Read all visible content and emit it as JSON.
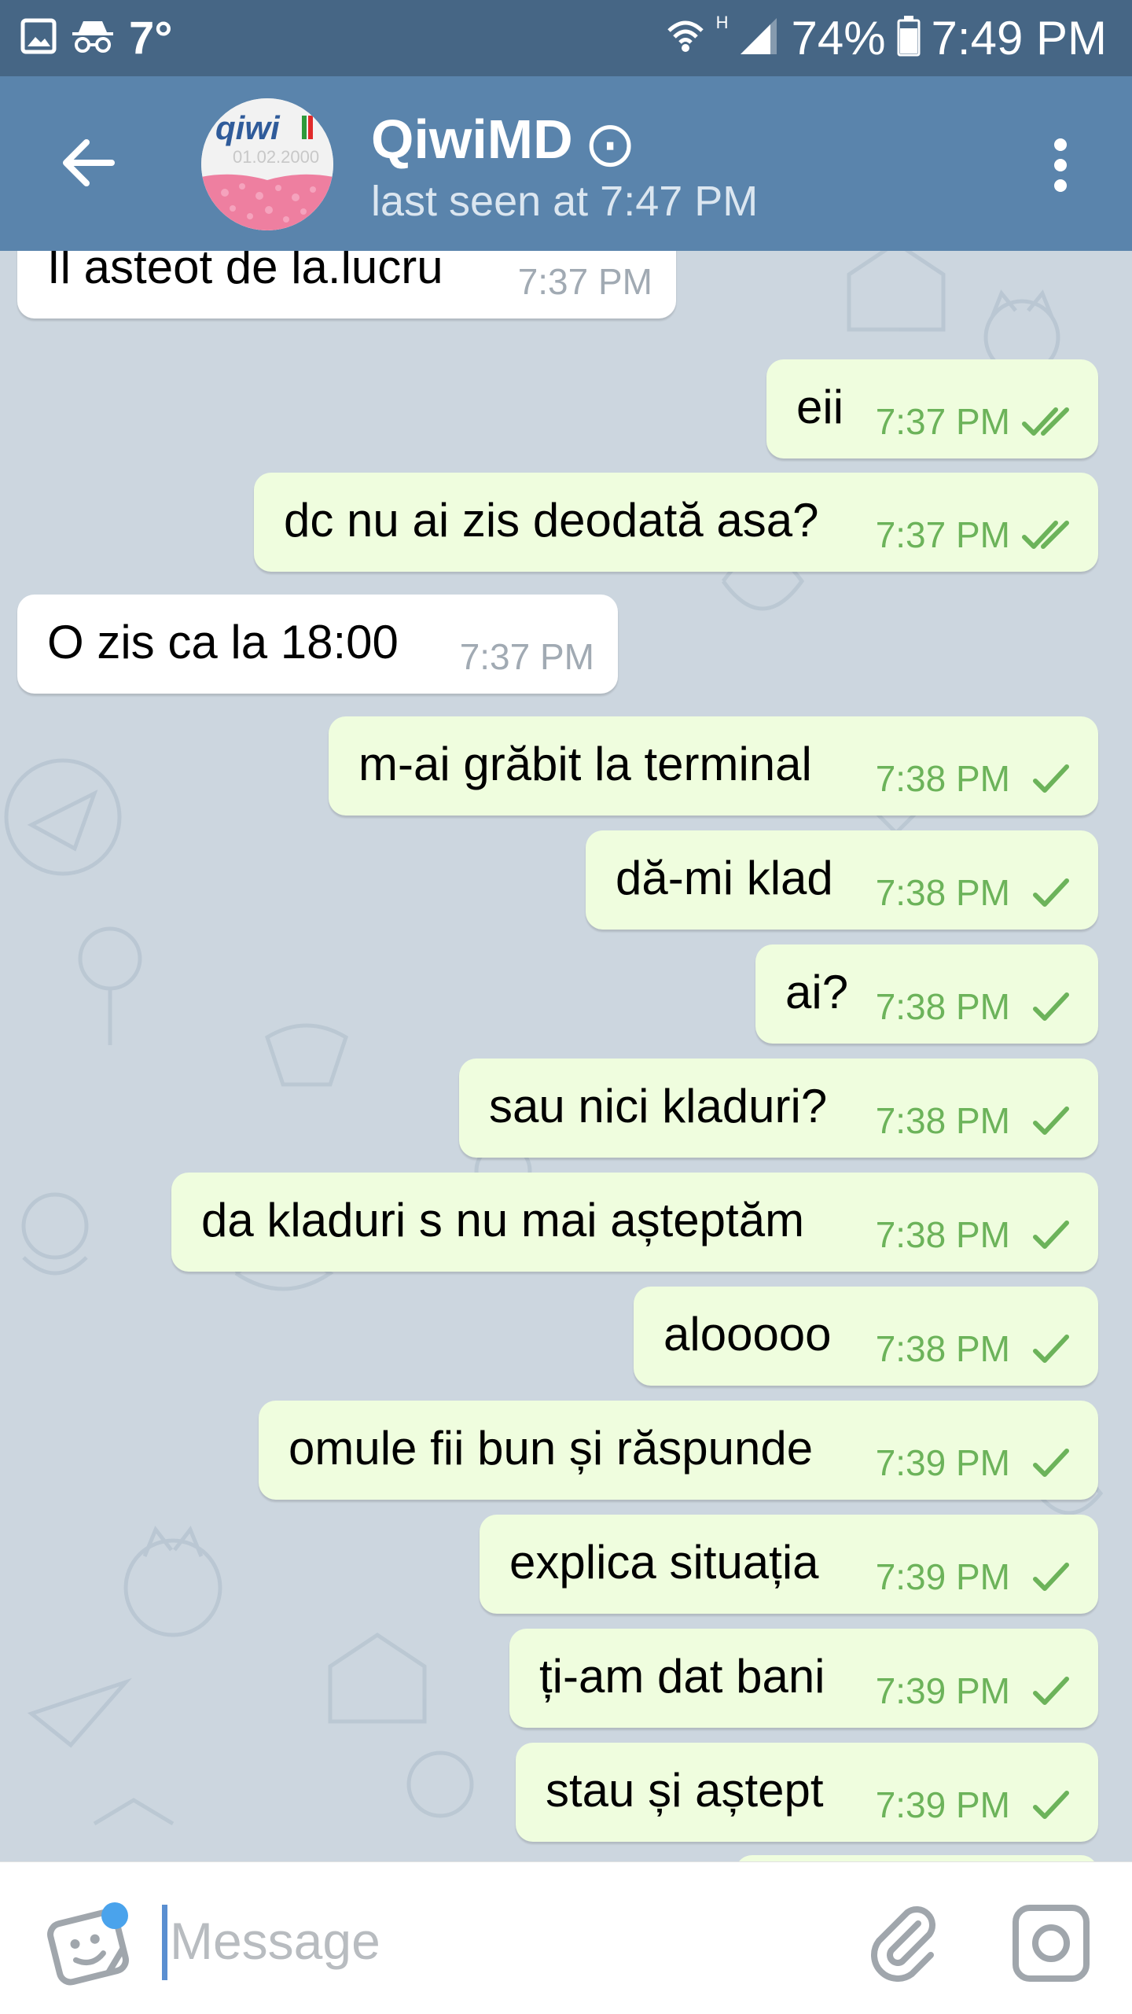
{
  "status_bar": {
    "temperature": "7°",
    "network_type": "H",
    "battery": "74%",
    "time": "7:49 PM",
    "icons": [
      "gallery-icon",
      "incognito-icon",
      "wifi-icon",
      "signal-icon",
      "battery-icon"
    ]
  },
  "header": {
    "title": "QiwiMD",
    "title_suffix": "⨀",
    "subtitle": "last seen at 7:47 PM",
    "avatar_text": "qiwi",
    "avatar_date": "01.02.2000"
  },
  "messages": [
    {
      "dir": "in",
      "text": "Il asteot de la.lucru",
      "time": "7:37 PM"
    },
    {
      "dir": "out",
      "text": "eii",
      "time": "7:37 PM",
      "status": "read"
    },
    {
      "dir": "out",
      "text": "dc nu ai zis deodată asa?",
      "time": "7:37 PM",
      "status": "read"
    },
    {
      "dir": "in",
      "text": "O zis ca la 18:00",
      "time": "7:37 PM"
    },
    {
      "dir": "out",
      "text": "m-ai grăbit la terminal",
      "time": "7:38 PM",
      "status": "sent"
    },
    {
      "dir": "out",
      "text": "dă-mi klad",
      "time": "7:38 PM",
      "status": "sent"
    },
    {
      "dir": "out",
      "text": "ai?",
      "time": "7:38 PM",
      "status": "sent"
    },
    {
      "dir": "out",
      "text": "sau nici kladuri?",
      "time": "7:38 PM",
      "status": "sent"
    },
    {
      "dir": "out",
      "text": "da kladuri s nu mai așteptăm",
      "time": "7:38 PM",
      "status": "sent"
    },
    {
      "dir": "out",
      "text": "alooooo",
      "time": "7:38 PM",
      "status": "sent"
    },
    {
      "dir": "out",
      "text": "omule fii bun și răspunde",
      "time": "7:39 PM",
      "status": "sent"
    },
    {
      "dir": "out",
      "text": "explica situația",
      "time": "7:39 PM",
      "status": "sent"
    },
    {
      "dir": "out",
      "text": "ți-am dat bani",
      "time": "7:39 PM",
      "status": "sent"
    },
    {
      "dir": "out",
      "text": "stau și aștept",
      "time": "7:39 PM",
      "status": "sent"
    }
  ],
  "input": {
    "placeholder": "Message",
    "value": ""
  },
  "colors": {
    "status_bar": "#466685",
    "header": "#5a84ac",
    "chat_background": "#ccd6df",
    "outgoing_bubble": "#effdde",
    "incoming_bubble": "#ffffff",
    "outgoing_time": "#6cb35a",
    "incoming_time": "#a1aab3"
  }
}
